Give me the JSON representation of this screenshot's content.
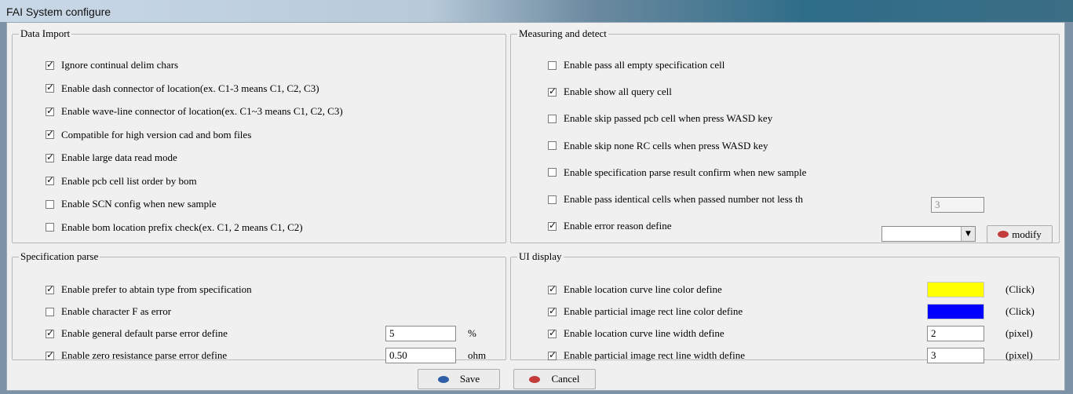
{
  "window": {
    "title": "FAI System configure"
  },
  "data_import": {
    "legend": "Data Import",
    "items": [
      {
        "label": "Ignore continual delim chars",
        "checked": true
      },
      {
        "label": "Enable dash connector of location(ex. C1-3 means C1, C2, C3)",
        "checked": true
      },
      {
        "label": "Enable wave-line connector of location(ex. C1~3 means C1, C2, C3)",
        "checked": true
      },
      {
        "label": "Compatible for high version cad and bom files",
        "checked": true
      },
      {
        "label": "Enable large data read mode",
        "checked": true
      },
      {
        "label": "Enable pcb cell list order by bom",
        "checked": true
      },
      {
        "label": "Enable SCN config when new sample",
        "checked": false
      },
      {
        "label": "Enable bom location prefix check(ex. C1, 2 means C1, C2)",
        "checked": false
      }
    ]
  },
  "measuring": {
    "legend": "Measuring and detect",
    "items": [
      {
        "label": "Enable pass all empty specification cell",
        "checked": false
      },
      {
        "label": "Enable show all query cell",
        "checked": true
      },
      {
        "label": "Enable skip passed pcb cell when press WASD key",
        "checked": false
      },
      {
        "label": "Enable skip none RC cells when press WASD key",
        "checked": false
      },
      {
        "label": "Enable specification parse result confirm when new sample",
        "checked": false
      },
      {
        "label": "Enable pass identical cells when passed number not less th",
        "checked": false
      },
      {
        "label": "Enable error reason define",
        "checked": true
      }
    ],
    "identical_number": "3",
    "error_reason_selected": "",
    "modify_label": "modify"
  },
  "spec_parse": {
    "legend": "Specification parse",
    "items": [
      {
        "label": "Enable prefer to abtain type from specification",
        "checked": true
      },
      {
        "label": "Enable character F as error",
        "checked": false
      },
      {
        "label": "Enable general default parse error define",
        "checked": true
      },
      {
        "label": "Enable zero resistance parse error define",
        "checked": true
      }
    ],
    "general_value": "5",
    "general_unit": "%",
    "zero_value": "0.50",
    "zero_unit": "ohm"
  },
  "ui_display": {
    "legend": "UI display",
    "items": [
      {
        "label": "Enable location curve line color define",
        "checked": true
      },
      {
        "label": "Enable particial image rect line color define",
        "checked": true
      },
      {
        "label": "Enable location curve line width define",
        "checked": true
      },
      {
        "label": "Enable particial image rect line width define",
        "checked": true
      }
    ],
    "curve_color": "#ffff00",
    "rect_color": "#0000ff",
    "click_label": "(Click)",
    "curve_width": "2",
    "rect_width": "3",
    "pixel_label": "(pixel)"
  },
  "footer": {
    "save_label": "Save",
    "cancel_label": "Cancel"
  },
  "colors": {
    "save_dot": "#2f5fa8",
    "cancel_dot": "#c43b3b",
    "modify_dot": "#c43b3b"
  }
}
